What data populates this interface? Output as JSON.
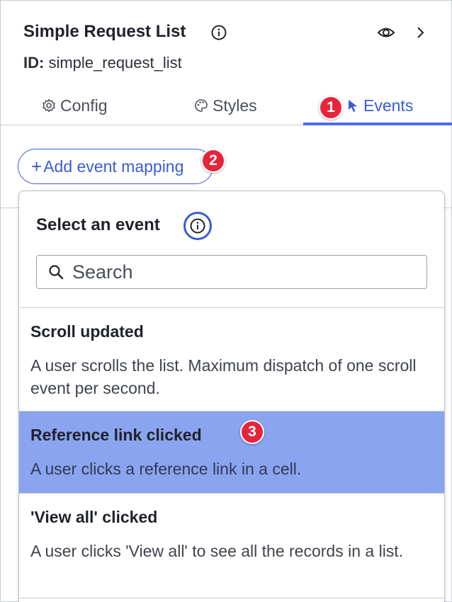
{
  "header": {
    "title": "Simple Request List",
    "id_label": "ID:",
    "id_value": "simple_request_list"
  },
  "tabs": [
    {
      "label": "Config",
      "icon": "gear-icon"
    },
    {
      "label": "Styles",
      "icon": "palette-icon"
    },
    {
      "label": "Events",
      "icon": "cursor-icon",
      "active": true
    }
  ],
  "badges": [
    "1",
    "2",
    "3"
  ],
  "add_button": {
    "label": "Add event mapping"
  },
  "dropdown": {
    "title": "Select an event",
    "search_placeholder": "Search",
    "events": [
      {
        "name": "Scroll updated",
        "description": "A user scrolls the list. Maximum dispatch of one scroll event per second."
      },
      {
        "name": "Reference link clicked",
        "description": "A user clicks a reference link in a cell.",
        "selected": true
      },
      {
        "name": "'View all' clicked",
        "description": "A user clicks 'View all' to see all the records in a list."
      }
    ]
  },
  "colors": {
    "accent": "#3b5bd9",
    "selected_row": "#8aa4ef",
    "badge": "#e5253c"
  }
}
